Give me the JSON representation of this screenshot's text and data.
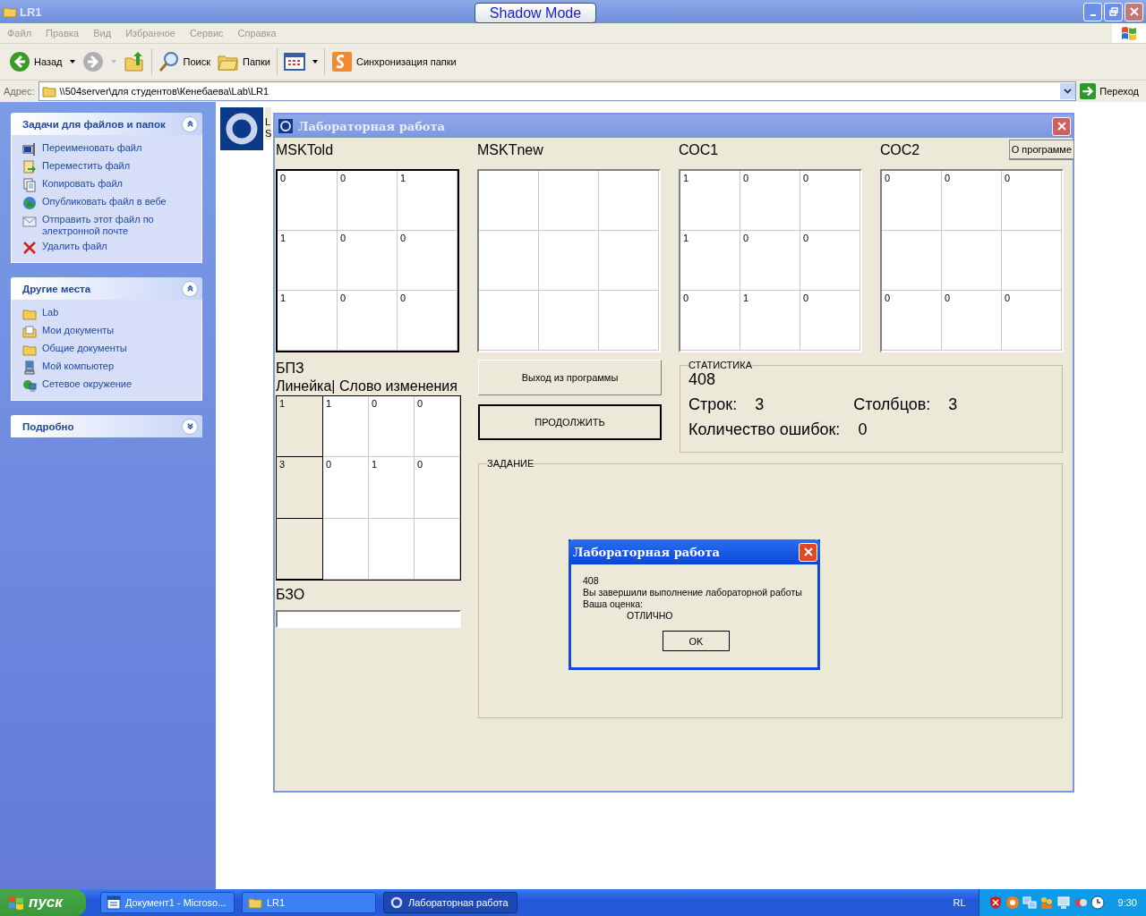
{
  "window": {
    "title": "LR1",
    "shadow_mode_button": "Shadow Mode"
  },
  "menu": [
    "Файл",
    "Правка",
    "Вид",
    "Избранное",
    "Сервис",
    "Справка"
  ],
  "toolbar": [
    {
      "kind": "back",
      "label": "Назад",
      "disabled": false
    },
    {
      "kind": "forward",
      "disabled": true
    },
    {
      "kind": "up"
    },
    {
      "kind": "search",
      "label": "Поиск"
    },
    {
      "kind": "folders",
      "label": "Папки"
    },
    {
      "kind": "views"
    },
    {
      "kind": "sync",
      "label": "Синхронизация папки"
    }
  ],
  "address": {
    "label": "Адрес:",
    "value": "\\\\504server\\для студентов\\Кенебаева\\Lab\\LR1",
    "go": "Переход"
  },
  "sidebar": [
    {
      "title": "Задачи для файлов и папок",
      "expanded": true,
      "items": [
        "Переименовать файл",
        "Переместить файл",
        "Копировать файл",
        "Опубликовать файл в вебе",
        "Отправить этот файл по электронной почте",
        "Удалить файл"
      ]
    },
    {
      "title": "Другие места",
      "expanded": true,
      "items": [
        "Lab",
        "Мои документы",
        "Общие документы",
        "Мой компьютер",
        "Сетевое окружение"
      ]
    },
    {
      "title": "Подробно",
      "expanded": false
    }
  ],
  "file_item": {
    "name_lines": [
      "L",
      "S"
    ]
  },
  "lab_window": {
    "title": "Лабораторная работа",
    "about_button": "О программе",
    "grids": [
      {
        "label": "MSKTold",
        "focused": true,
        "cells": [
          [
            "0",
            "0",
            "1"
          ],
          [
            "1",
            "0",
            "0"
          ],
          [
            "1",
            "0",
            "0"
          ]
        ]
      },
      {
        "label": "MSKTnew",
        "focused": false
      },
      {
        "label": "СОС1",
        "focused": false,
        "cells": [
          [
            "1",
            "0",
            "0"
          ],
          [
            "1",
            "0",
            "0"
          ],
          [
            "0",
            "1",
            "0"
          ]
        ]
      },
      {
        "label": "СОС2",
        "focused": false,
        "cells": [
          [
            "0",
            "0",
            "0"
          ],
          null,
          [
            "0",
            "0",
            "0"
          ]
        ]
      }
    ],
    "bpz": {
      "label": "БПЗ",
      "header": "Линейка| Слово изменения",
      "rows": [
        {
          "ruler": "1",
          "word": [
            "1",
            "0",
            "0"
          ]
        },
        {
          "ruler": "3",
          "word": [
            "0",
            "1",
            "0"
          ]
        }
      ]
    },
    "bzo": {
      "label": "БЗО"
    },
    "exit_button": {
      "label": "Выход из программы",
      "focused": false
    },
    "continue_button": {
      "label": "ПРОДОЛЖИТЬ",
      "focused": true
    },
    "stats": {
      "title": "СТАТИСТИКА",
      "value": "408",
      "rows_label": "Строк:",
      "rows": "3",
      "cols_label": "Столбцов:",
      "cols": "3",
      "errors_label": "Количество ошибок:",
      "errors": "0"
    },
    "task": {
      "title": "ЗАДАНИЕ"
    }
  },
  "dialog": {
    "title": "Лабораторная работа",
    "lines": [
      "408",
      "Вы завершили выполнение лабораторной работы",
      "Ваша оценка:"
    ],
    "grade": "ОТЛИЧНО",
    "ok": "OK"
  },
  "taskbar": {
    "start": "пуск",
    "tasks": [
      {
        "kind": "word",
        "label": "Документ1 - Microso...",
        "selected": false
      },
      {
        "kind": "folder",
        "label": "LR1",
        "selected": false
      },
      {
        "kind": "app",
        "label": "Лабораторная работа",
        "selected": true
      }
    ],
    "language": "RL",
    "clock": "9:30"
  }
}
